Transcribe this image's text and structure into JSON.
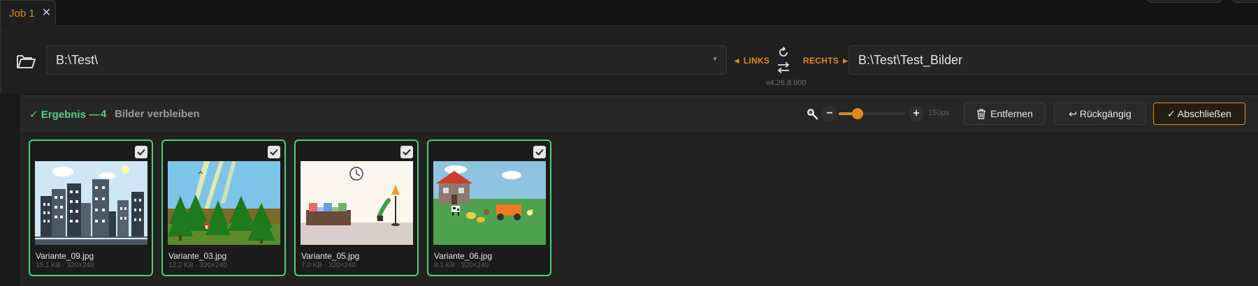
{
  "tab": {
    "title": "Job 1",
    "close_icon": "close-icon"
  },
  "paths": {
    "left_path": "B:\\Test\\",
    "left_label": "◄ LINKS",
    "right_label": "RECHTS ►",
    "right_path": "B:\\Test\\Test_Bilder",
    "version": "v4.26.8.900"
  },
  "result": {
    "check_label": "✓ Ergebnis —",
    "count": "4",
    "remaining_text": "Bilder verbleiben"
  },
  "zoom": {
    "minus": "−",
    "plus": "+",
    "value_label": "150px",
    "level": 0.28
  },
  "buttons": {
    "remove": "Entfernen",
    "undo": "↩ Rückgängig",
    "finish": "✓ Abschließen"
  },
  "colors": {
    "accent": "#e08a1e",
    "success": "#56d17a",
    "card_border": "#4fd07a"
  },
  "images": [
    {
      "name": "Variante_09.jpg",
      "meta": "15.1 KB · 320×240",
      "selected": true,
      "scene": "city"
    },
    {
      "name": "Variante_03.jpg",
      "meta": "12.2 KB · 320×240",
      "selected": true,
      "scene": "forest"
    },
    {
      "name": "Variante_05.jpg",
      "meta": "7.0 KB · 320×240",
      "selected": true,
      "scene": "room"
    },
    {
      "name": "Variante_06.jpg",
      "meta": "9.1 KB · 320×240",
      "selected": true,
      "scene": "farm"
    }
  ]
}
